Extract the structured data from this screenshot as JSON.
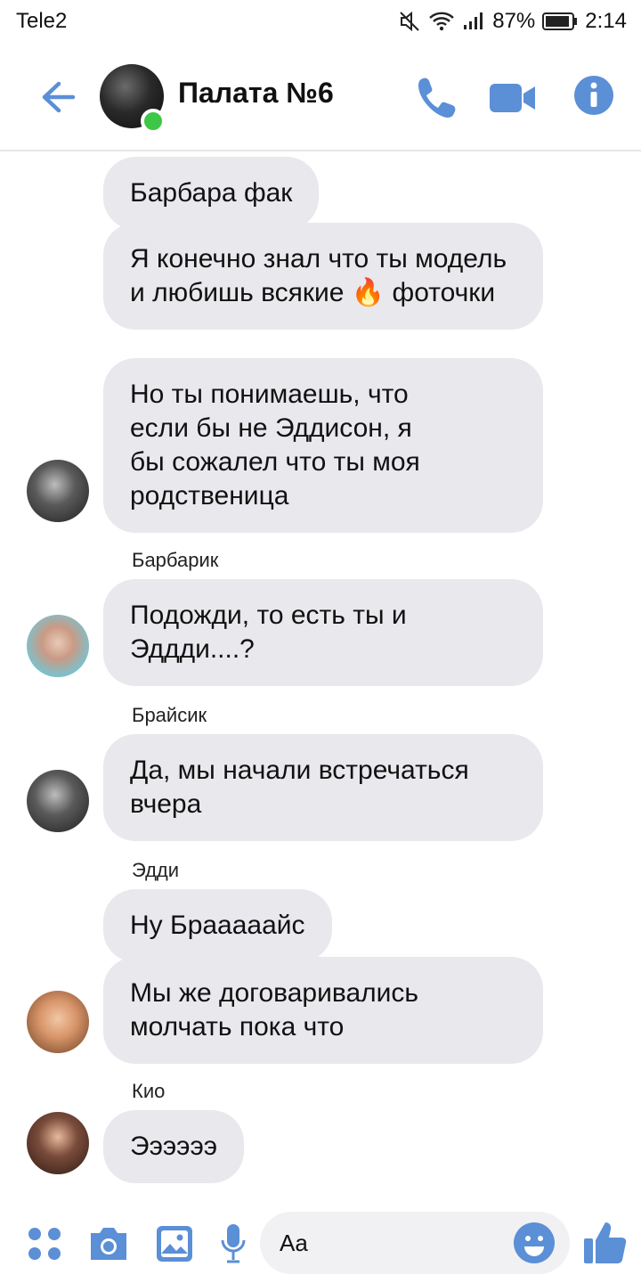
{
  "status": {
    "carrier": "Tele2",
    "battery": "87%",
    "time": "2:14"
  },
  "header": {
    "title": "Палата №6",
    "back_icon": "back-arrow-icon",
    "call_icon": "phone-icon",
    "video_icon": "video-camera-icon",
    "info_icon": "info-icon",
    "accent": "#5b8fd6"
  },
  "messages": [
    {
      "sender": "",
      "text": "Барбара фак"
    },
    {
      "sender": "",
      "text": "Я конечно знал что ты модель и любишь всякие 🔥 фоточки"
    },
    {
      "sender": "",
      "text": "Но ты понимаешь, что если бы не Эддисон, я бы сожалел что ты моя родственица"
    },
    {
      "sender": "Барбарик",
      "text": "Подожди, то есть ты и Эддди....?"
    },
    {
      "sender": "Брайсик",
      "text": "Да, мы начали встречаться вчера"
    },
    {
      "sender": "Эдди",
      "text": "Ну Брааааайс"
    },
    {
      "sender": "",
      "text": "Мы же договаривались молчать пока что"
    },
    {
      "sender": "Кио",
      "text": "Ээээээ"
    }
  ],
  "composer": {
    "placeholder": "Aa"
  },
  "bubble_color": "#e9e8ec",
  "online_color": "#3ec746"
}
